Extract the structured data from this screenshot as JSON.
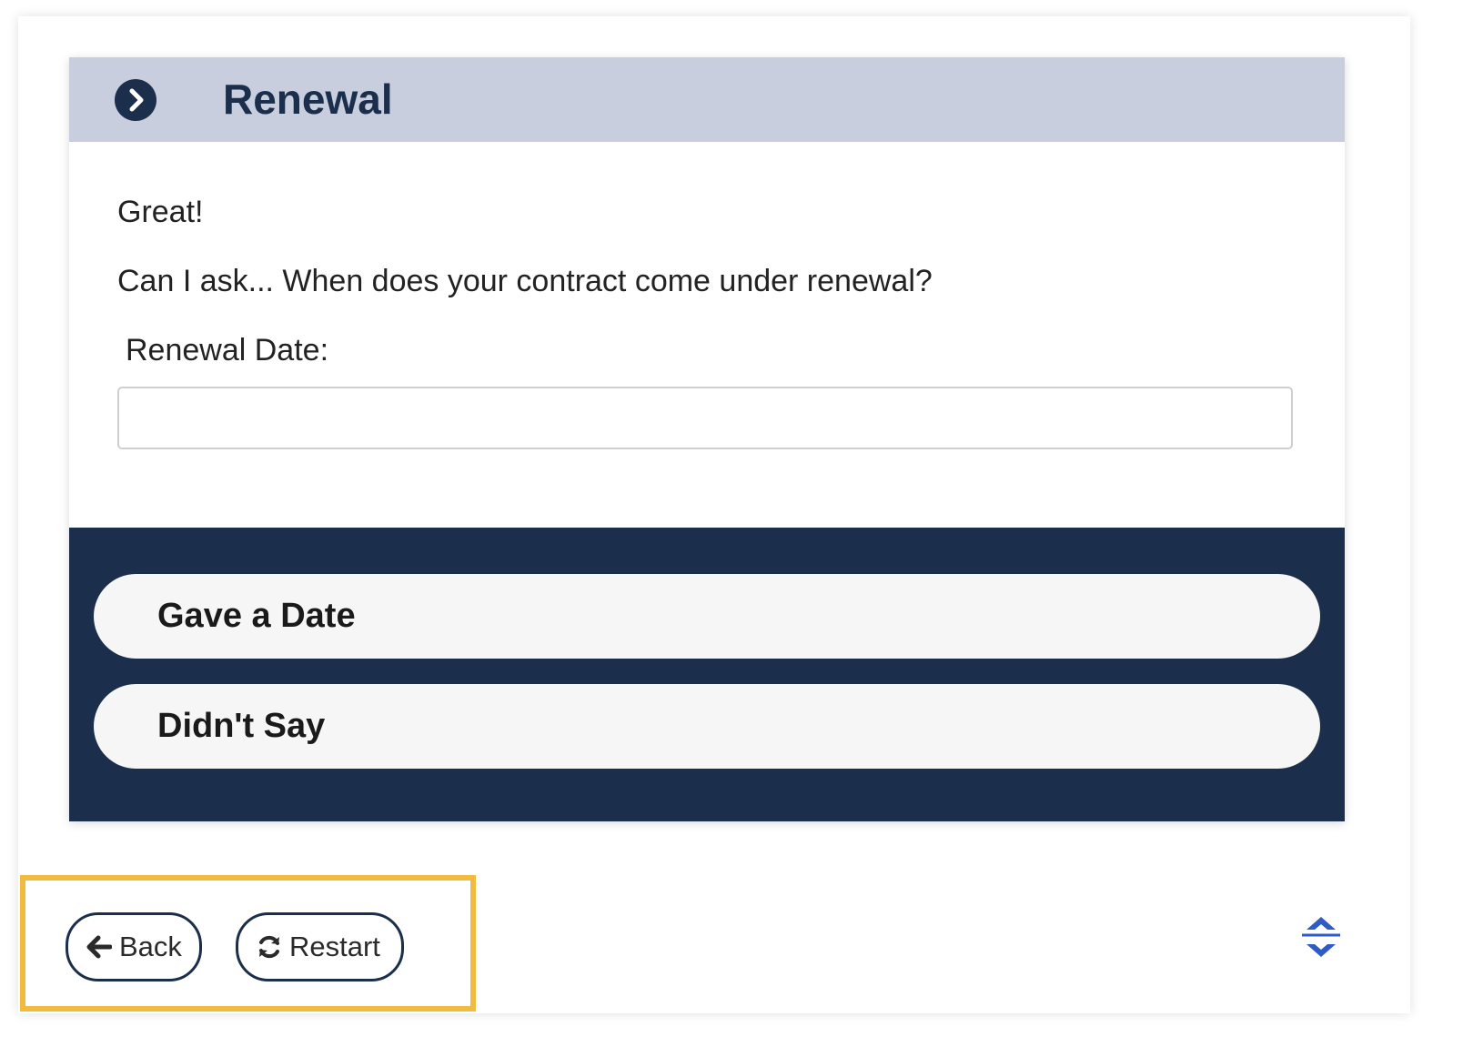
{
  "header": {
    "title": "Renewal",
    "icon": "chevron-right-circle-icon"
  },
  "body": {
    "greeting": "Great!",
    "question": "Can I ask... When does your contract come under renewal?",
    "date_label": "Renewal Date:",
    "date_value": ""
  },
  "choices": [
    {
      "label": "Gave a Date"
    },
    {
      "label": "Didn't Say"
    }
  ],
  "footer": {
    "back_label": "Back",
    "back_icon": "arrow-left-icon",
    "restart_label": "Restart",
    "restart_icon": "refresh-icon",
    "collapse_icon": "collapse-arrows-icon"
  },
  "colors": {
    "header_bg": "#c8cedd",
    "navy": "#1b2e4b",
    "highlight": "#f0bb3e",
    "collapse_icon": "#2f5bc4"
  }
}
